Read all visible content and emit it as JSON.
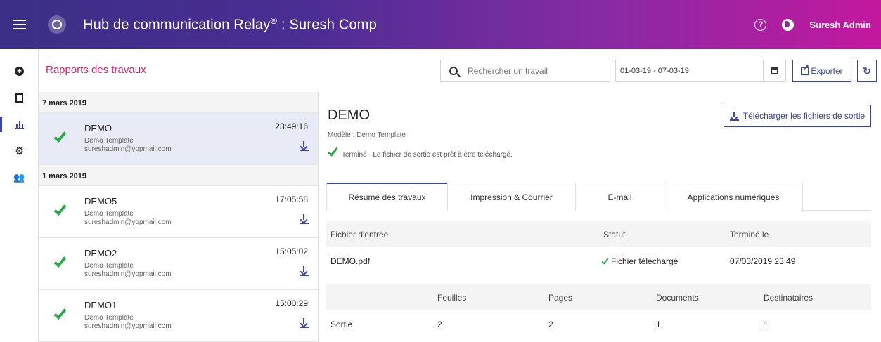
{
  "app": {
    "title": "Hub de communication Relay",
    "title_reg": "®",
    "title_suffix": " : Suresh Comp",
    "user": "Suresh Admin"
  },
  "subheader": {
    "page_title": "Rapports des travaux",
    "search_placeholder": "Rechercher un travail",
    "date_range": "01-03-19 - 07-03-19",
    "export_label": "Exporter"
  },
  "jobs": {
    "groups": [
      {
        "date": "7 mars 2019"
      },
      {
        "date": "1 mars 2019"
      }
    ],
    "items": [
      {
        "name": "DEMO",
        "template": "Demo Template",
        "email": "sureshadmin@yopmail.com",
        "time": "23:49:16"
      },
      {
        "name": "DEMO5",
        "template": "Demo Template",
        "email": "sureshadmin@yopmail.com",
        "time": "17:05:58"
      },
      {
        "name": "DEMO2",
        "template": "Demo Template",
        "email": "sureshadmin@yopmail.com",
        "time": "15:05:02"
      },
      {
        "name": "DEMO1",
        "template": "Demo Template",
        "email": "sureshadmin@yopmail.com",
        "time": "15:00:29"
      }
    ]
  },
  "detail": {
    "title": "DEMO",
    "model": "Modèle : Demo Template",
    "status_label": "Terminé",
    "status_message": "Le fichier de sortie est prêt à être téléchargé.",
    "download_all_label": "Télécharger les fichiers de sortie",
    "tabs": [
      {
        "label": "Résumé des travaux"
      },
      {
        "label": "Impression & Courrier"
      },
      {
        "label": "E-mail"
      },
      {
        "label": "Applications numériques"
      }
    ],
    "files_table": {
      "headers": [
        "Fichier d'entrée",
        "Statut",
        "Terminé le"
      ],
      "row": {
        "file": "DEMO.pdf",
        "status": "Fichier téléchargé",
        "completed": "07/03/2019 23:49"
      }
    },
    "stats_table": {
      "headers": [
        "Feuilles",
        "Pages",
        "Documents",
        "Destinataires"
      ],
      "row": {
        "label": "Sortie",
        "sheets": "2",
        "pages": "2",
        "documents": "1",
        "recipients": "1"
      }
    }
  },
  "colors": {
    "accent": "#3b46a8",
    "title_pink": "#d6246e",
    "success": "#2aa84a"
  }
}
